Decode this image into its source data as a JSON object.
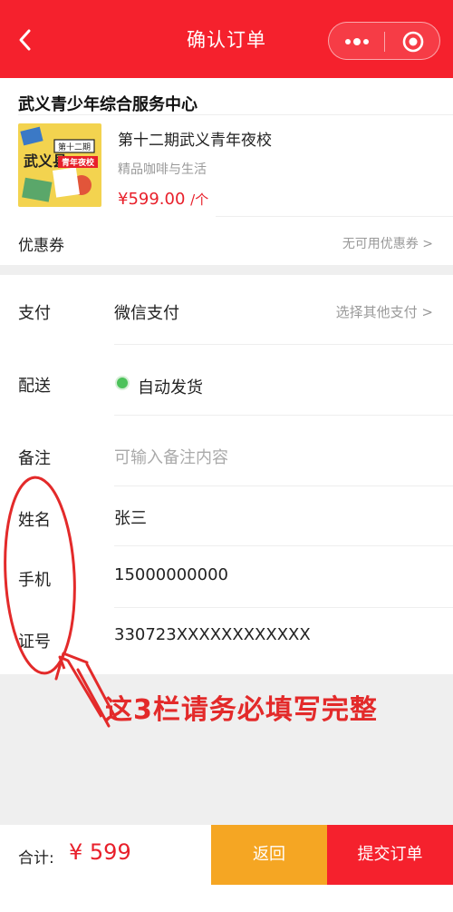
{
  "colors": {
    "brand": "#f5212d",
    "price": "#e8202b",
    "back_button": "#f5a623",
    "status_dot": "#4cc25a",
    "annotation": "#e32a2a"
  },
  "navbar": {
    "title": "确认订单",
    "back_icon": "chevron-left-icon",
    "more_icon": "more-dots-icon",
    "close_icon": "target-close-icon"
  },
  "shop": {
    "name": "武义青少年综合服务中心"
  },
  "product": {
    "title": "第十二期武义青年夜校",
    "subtitle": "精品咖啡与生活",
    "price": "¥599.00",
    "unit": "/个",
    "thumb_text_top": "第十二期",
    "thumb_text_main": "武义县",
    "thumb_text_banner": "青年夜校"
  },
  "coupon": {
    "label": "优惠券",
    "value": "无可用优惠券 >"
  },
  "form": {
    "payment": {
      "label": "支付",
      "value": "微信支付",
      "action": "选择其他支付 >"
    },
    "delivery": {
      "label": "配送",
      "value": "自动发货"
    },
    "remark": {
      "label": "备注",
      "placeholder": "可输入备注内容"
    },
    "name": {
      "label": "姓名",
      "value": "张三"
    },
    "phone": {
      "label": "手机",
      "value": "15000000000"
    },
    "id_number": {
      "label": "证号",
      "value": "330723XXXXXXXXXXXX"
    }
  },
  "annotation": {
    "text": "这3栏请务必填写完整"
  },
  "bottom": {
    "total_label": "合计:",
    "total_value": "¥ 599",
    "back_label": "返回",
    "submit_label": "提交订单"
  }
}
